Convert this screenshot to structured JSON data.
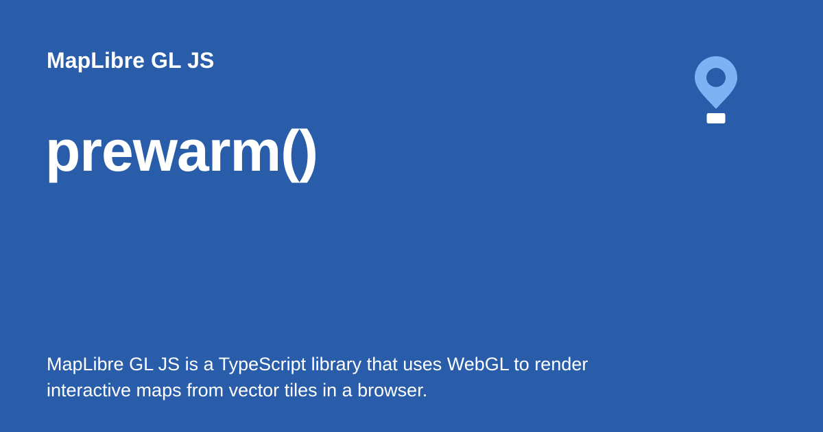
{
  "card": {
    "site_name": "MapLibre GL JS",
    "page_title": "prewarm()",
    "description": "MapLibre GL JS is a TypeScript library that uses WebGL to render interactive maps from vector tiles in a browser."
  },
  "logo": {
    "icon": "map-pin-icon",
    "pin_color": "#7FB2F5",
    "base_color": "#FFFFFF"
  },
  "colors": {
    "background": "#295DAA",
    "text": "#FFFFFF"
  }
}
